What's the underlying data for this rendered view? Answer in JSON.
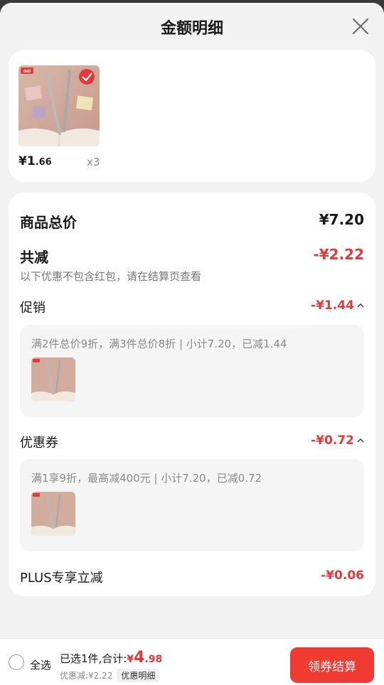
{
  "header": {
    "title": "金额明细"
  },
  "product": {
    "price_currency": "¥",
    "price_int": "1",
    "price_dec": ".66",
    "quantity": "x3",
    "brand_logo_text": "deli"
  },
  "summary": {
    "total_label": "商品总价",
    "total_value": "¥7.20",
    "reduce_label": "共减",
    "reduce_value": "-¥2.22",
    "note": "以下优惠不包含红包，请在结算页查看"
  },
  "promotion": {
    "label": "促销",
    "value": "-¥1.44",
    "detail": "满2件总价9折，满3件总价8折 | 小计7.20，已减1.44"
  },
  "coupon": {
    "label": "优惠券",
    "value": "-¥0.72",
    "detail": "满1享9折，最高减400元 | 小计7.20，已减0.72"
  },
  "plus": {
    "label": "PLUS专享立减",
    "value": "-¥0.06"
  },
  "bottom": {
    "select_all": "全选",
    "selected_text": "已选1件,合计:",
    "total_currency": "¥",
    "total_int": "4",
    "total_dec": ".98",
    "discount_text": "优惠减:¥2.22",
    "detail_chip": "优惠明细",
    "checkout": "领券结算"
  },
  "colors": {
    "accent_red": "#e4393c",
    "button_red": "#f23b30"
  }
}
